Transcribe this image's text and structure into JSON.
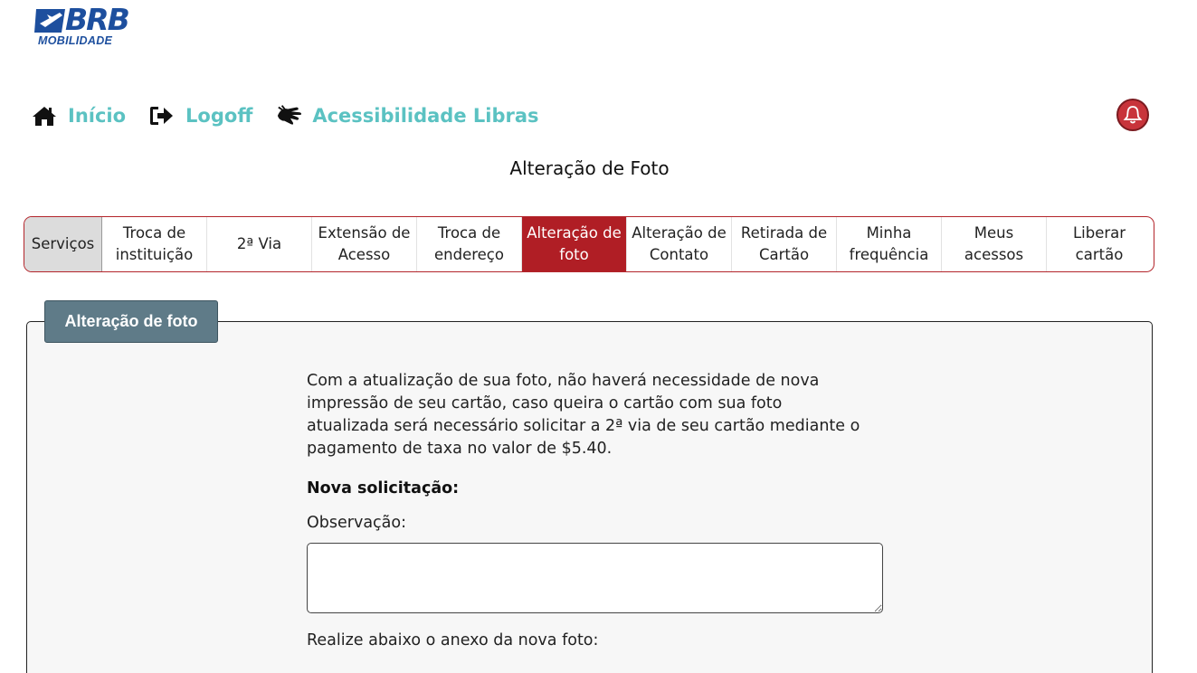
{
  "logo": {
    "brand": "BRB",
    "subtitle": "MOBILIDADE"
  },
  "nav": {
    "items": [
      {
        "label": "Início",
        "icon": "home-icon"
      },
      {
        "label": "Logoff",
        "icon": "sign-out-icon"
      },
      {
        "label": "Acessibilidade Libras",
        "icon": "sign-language-icon"
      }
    ],
    "notification_icon": "bell-icon"
  },
  "page_title": "Alteração de Foto",
  "tabs": [
    {
      "label": "Serviços"
    },
    {
      "label": "Troca de instituição"
    },
    {
      "label": "2ª Via"
    },
    {
      "label": "Extensão de Acesso"
    },
    {
      "label": "Troca de endereço"
    },
    {
      "label": "Alteração de foto",
      "active": true
    },
    {
      "label": "Alteração de Contato"
    },
    {
      "label": "Retirada de Cartão"
    },
    {
      "label": "Minha frequência"
    },
    {
      "label": "Meus acessos"
    },
    {
      "label": "Liberar cartão"
    }
  ],
  "panel": {
    "legend": "Alteração de foto",
    "info": "Com a atualização de sua foto, não haverá necessidade de nova impressão de seu cartão, caso queira o cartão com sua foto atualizada será necessário solicitar a 2ª via de seu cartão mediante o pagamento de taxa no valor de $5.40.",
    "request_title": "Nova solicitação:",
    "observation_label": "Observação:",
    "observation_value": "",
    "annex_label": "Realize abaixo o anexo da nova foto:"
  },
  "colors": {
    "brand_blue": "#1d4f9e",
    "nav_teal": "#5bc2c2",
    "accent_red": "#b01e25",
    "legend_gray": "#5f7b88"
  }
}
